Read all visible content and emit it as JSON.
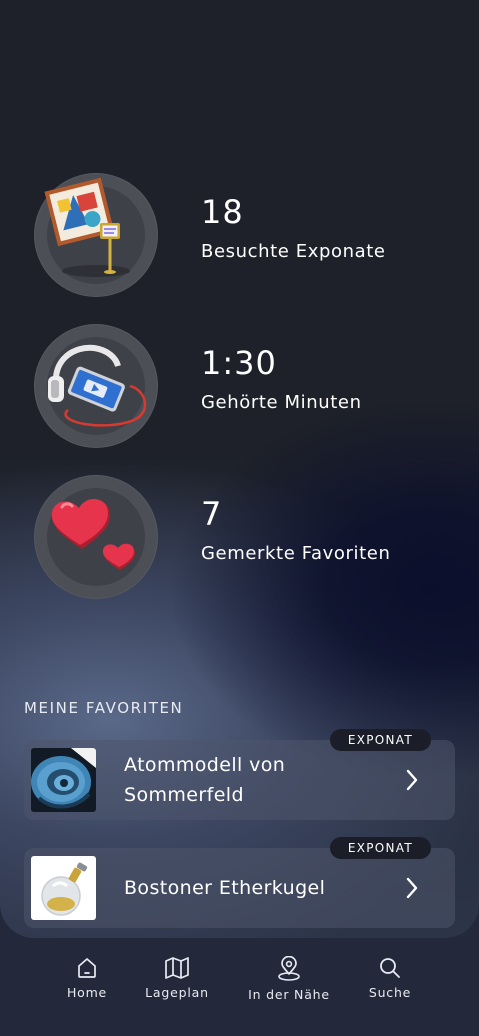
{
  "stats": [
    {
      "value": "18",
      "label": "Besuchte Exponate",
      "icon": "painting-easel-icon"
    },
    {
      "value": "1:30",
      "label": "Gehörte Minuten",
      "icon": "headphones-tablet-icon"
    },
    {
      "value": "7",
      "label": "Gemerkte Favoriten",
      "icon": "hearts-icon"
    }
  ],
  "favorites": {
    "title": "MEINE FAVORITEN",
    "items": [
      {
        "badge": "EXPONAT",
        "title_line1": "Atommodell von",
        "title_line2": "Sommerfeld",
        "thumb": "atom-model-thumbnail"
      },
      {
        "badge": "EXPONAT",
        "title_line1": "Bostoner Etherkugel",
        "title_line2": "",
        "thumb": "ether-globe-thumbnail"
      }
    ]
  },
  "tabbar": {
    "tabs": [
      {
        "label": "Home",
        "icon": "home-icon"
      },
      {
        "label": "Lageplan",
        "icon": "map-icon"
      },
      {
        "label": "In der Nähe",
        "icon": "location-pin-icon"
      },
      {
        "label": "Suche",
        "icon": "search-icon"
      }
    ]
  },
  "colors": {
    "background": "#1e2129",
    "tabbar": "#23283b",
    "badge": "#1b1e28",
    "heart": "#e5344b"
  }
}
